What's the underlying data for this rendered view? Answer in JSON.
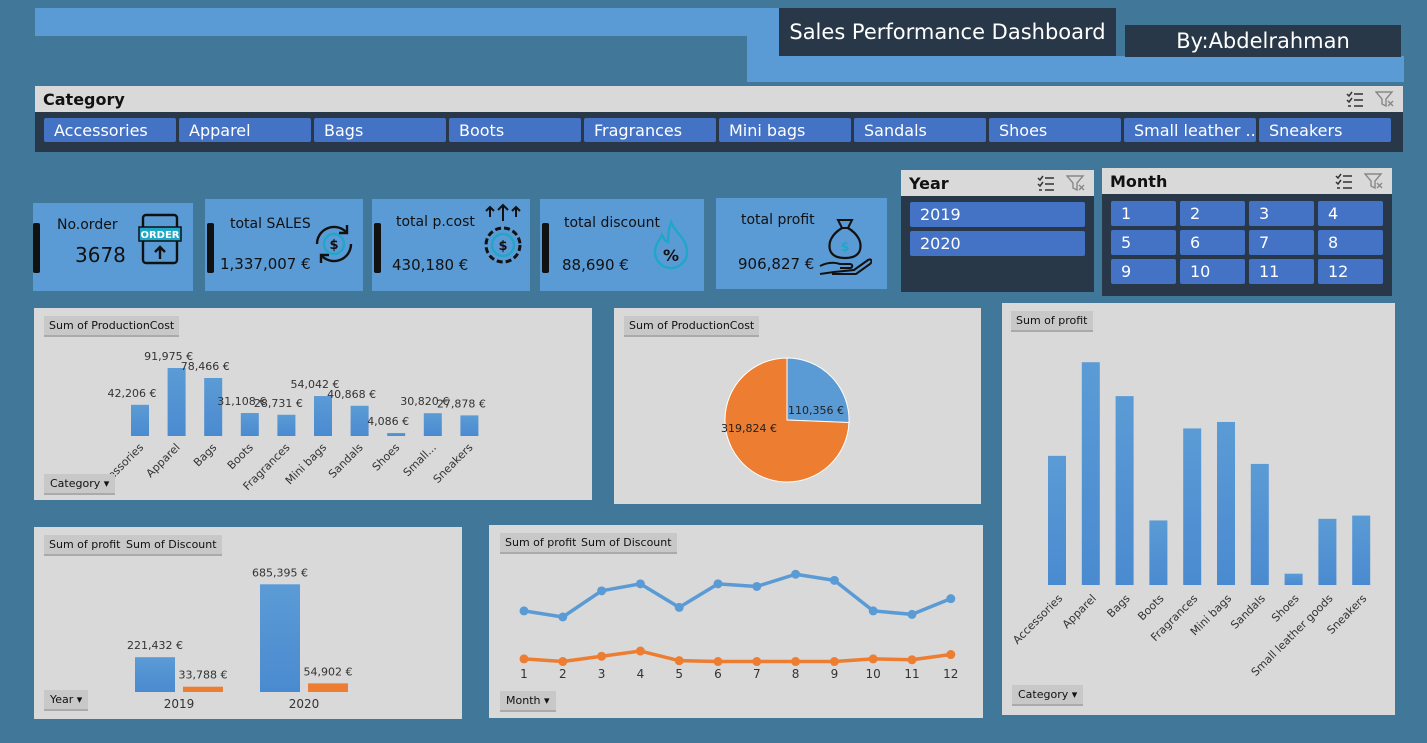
{
  "header": {
    "title": "Sales Performance Dashboard",
    "author": "By:Abdelrahman"
  },
  "category_slicer": {
    "title": "Category",
    "items": [
      "Accessories",
      "Apparel",
      "Bags",
      "Boots",
      "Fragrances",
      "Mini bags",
      "Sandals",
      "Shoes",
      "Small leather ...",
      "Sneakers"
    ]
  },
  "year_slicer": {
    "title": "Year",
    "items": [
      "2019",
      "2020"
    ]
  },
  "month_slicer": {
    "title": "Month",
    "items": [
      "1",
      "2",
      "3",
      "4",
      "5",
      "6",
      "7",
      "8",
      "9",
      "10",
      "11",
      "12"
    ]
  },
  "kpis": {
    "orders": {
      "label": "No.order",
      "value": "3678",
      "icon": "order-icon"
    },
    "sales": {
      "label": "total SALES",
      "value": "1,337,007 €",
      "icon": "money-cycle-icon"
    },
    "pcost": {
      "label": "total p.cost",
      "value": "430,180 €",
      "icon": "money-gear-icon"
    },
    "discount": {
      "label": "total discount",
      "value": "88,690 €",
      "icon": "fire-percent-icon"
    },
    "profit": {
      "label": "total profit",
      "value": "906,827 €",
      "icon": "money-bag-hand-icon"
    }
  },
  "colors": {
    "blue": "#5b9bd5",
    "orange": "#ed7d31",
    "dark": "#283848",
    "slicer_btn": "#4472c4"
  },
  "chart_data": [
    {
      "type": "bar",
      "field_button": "Sum of ProductionCost",
      "axis_button": "Category",
      "categories": [
        "Accessories",
        "Apparel",
        "Bags",
        "Boots",
        "Fragrances",
        "Mini bags",
        "Sandals",
        "Shoes",
        "Small...",
        "Sneakers"
      ],
      "values": [
        42206,
        91975,
        78466,
        31108,
        28731,
        54042,
        40868,
        4086,
        30820,
        27878
      ],
      "labels": [
        "42,206 €",
        "91,975 €",
        "78,466 €",
        "31,108 €",
        "28,731 €",
        "54,042 €",
        "40,868 €",
        "4,086 €",
        "30,820 €",
        "27,878 €"
      ]
    },
    {
      "type": "pie",
      "field_button": "Sum of ProductionCost",
      "values": [
        110356,
        319824
      ],
      "labels": [
        "110,356 €",
        "319,824 €"
      ],
      "colors": [
        "#5b9bd5",
        "#ed7d31"
      ]
    },
    {
      "type": "bar",
      "field_button": "Sum of profit",
      "axis_button": "Category",
      "categories": [
        "Accessories",
        "Apparel",
        "Bags",
        "Boots",
        "Fragrances",
        "Mini bags",
        "Sandals",
        "Shoes",
        "Small leather goods",
        "Sneakers"
      ],
      "values": [
        80000,
        138000,
        117000,
        40000,
        97000,
        101000,
        75000,
        7000,
        41000,
        43000
      ]
    },
    {
      "type": "bar",
      "field_buttons": [
        "Sum of profit",
        "Sum of Discount"
      ],
      "axis_button": "Year",
      "categories": [
        "2019",
        "2020"
      ],
      "series": [
        {
          "values": [
            221432,
            685395
          ],
          "labels": [
            "221,432 €",
            "685,395 €"
          ]
        },
        {
          "values": [
            33788,
            54902
          ],
          "labels": [
            "33,788 €",
            "54,902 €"
          ]
        }
      ]
    },
    {
      "type": "line",
      "field_buttons": [
        "Sum of profit",
        "Sum of Discount"
      ],
      "axis_button": "Month",
      "x": [
        "1",
        "2",
        "3",
        "4",
        "5",
        "6",
        "7",
        "8",
        "9",
        "10",
        "11",
        "12"
      ],
      "series": [
        {
          "values": [
            62000,
            55000,
            85000,
            93000,
            66000,
            93000,
            90000,
            104000,
            97000,
            62000,
            58000,
            76000
          ]
        },
        {
          "values": [
            7000,
            4000,
            10000,
            16000,
            5000,
            4000,
            4000,
            4000,
            4000,
            7000,
            6000,
            12000
          ]
        }
      ]
    }
  ]
}
